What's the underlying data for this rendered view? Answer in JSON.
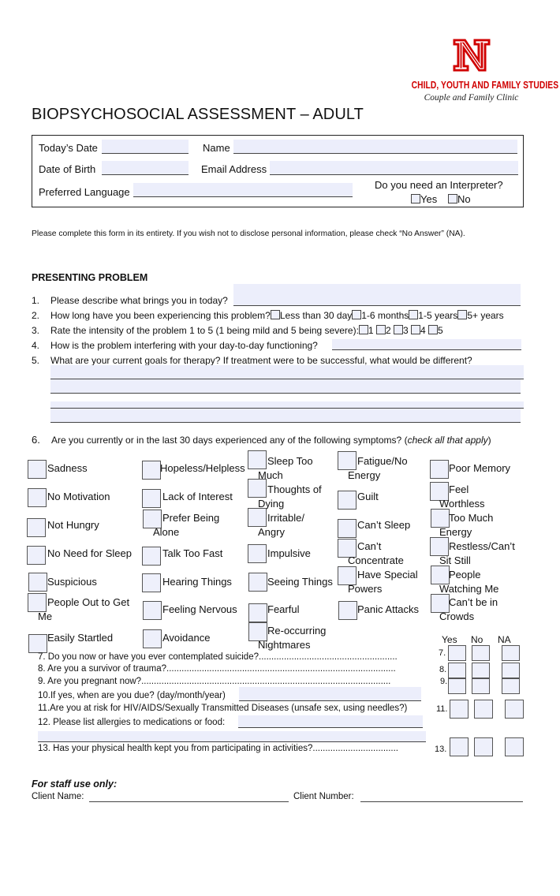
{
  "logo": {
    "icon": "university-n-logo-icon",
    "department": "CHILD, YOUTH AND FAMILY STUDIES",
    "clinic": "Couple and Family Clinic",
    "brand_color": "#d00000"
  },
  "title": "BIOPSYCHOSOCIAL ASSESSMENT – ADULT",
  "header": {
    "todays_date_label": "Today’s Date",
    "todays_date_value": "",
    "name_label": "Name",
    "name_value": "",
    "dob_label": "Date of Birth",
    "dob_value": "",
    "email_label": "Email Address",
    "email_value": "",
    "language_label": "Preferred Language",
    "language_value": "",
    "interpreter_question": "Do you need an Interpreter?",
    "interpreter_yes": "Yes",
    "interpreter_no": "No"
  },
  "instruction": "Please complete this form in its entirety. If you wish not to disclose personal information, please check “No Answer” (NA).",
  "presenting_problem": {
    "heading": "PRESENTING PROBLEM",
    "q1": {
      "num": "1.",
      "text": "Please describe what brings you in today?",
      "value": ""
    },
    "q2": {
      "num": "2.",
      "text": "How long have you been experiencing this problem?",
      "options": [
        "Less than 30 day",
        "1-6 months",
        "1-5 years",
        "5+ years"
      ]
    },
    "q3": {
      "num": "3.",
      "text": "Rate the intensity of the problem 1 to 5 (1 being mild and 5 being severe):",
      "options": [
        "1",
        "2",
        "3",
        "4",
        "5"
      ]
    },
    "q4": {
      "num": "4.",
      "text": "How is the problem interfering with your day-to-day functioning?",
      "value": ""
    },
    "q5": {
      "num": "5.",
      "text": "What are your current goals for therapy?  If treatment were to be successful, what would be different?",
      "lines": [
        "",
        "",
        "",
        ""
      ]
    }
  },
  "symptoms": {
    "num": "6.",
    "text": "Are you currently or in the last 30 days experienced any of the following symptoms? (",
    "hint": "check all that apply",
    "close": ")",
    "items": [
      "Sadness",
      "Hopeless/Helpless",
      "Sleep Too",
      "Much",
      "Fatigue/No",
      "Energy",
      "Poor Memory",
      "No Motivation",
      "Lack of Interest",
      "Thoughts of",
      "Dying",
      "Guilt",
      "Feel",
      "Worthless",
      "Not Hungry",
      "Prefer Being",
      "Alone",
      "Irritable/",
      "Angry",
      "Can’t Sleep",
      "Too Much",
      "Energy",
      "No Need for Sleep",
      "Talk Too Fast",
      "Impulsive",
      "Can’t",
      "Concentrate",
      "Restless/Can’t",
      "Sit Still",
      "Suspicious",
      "Hearing Things",
      "Seeing Things",
      "Have Special",
      "Powers",
      "People",
      "Watching Me",
      "People Out to Get",
      "Me",
      "Feeling Nervous",
      "Fearful",
      "Panic Attacks",
      "Can’t be in",
      "Crowds",
      "Easily Startled",
      "Avoidance",
      "Re-occurring",
      "Nightmares"
    ]
  },
  "yn_header": {
    "yes": "Yes",
    "no": "No",
    "na": "NA"
  },
  "health": {
    "q7": {
      "text": "7.  Do you now or have you ever contemplated suicide?.......................................................",
      "label": "7."
    },
    "q8": {
      "text": "8. Are you a survivor of trauma?...........................................................................................",
      "label": "8."
    },
    "q9": {
      "text": "9.  Are you pregnant now?...................................................................................................",
      "label": "9."
    },
    "q10": {
      "text": "10.If yes, when are you due? (day/month/year)",
      "value": ""
    },
    "q11": {
      "text": "11.Are you at risk for HIV/AIDS/Sexually Transmitted Diseases (unsafe sex, using needles?)",
      "label": "11."
    },
    "q12": {
      "text": "12. Please list allergies to medications or food:",
      "value": ""
    },
    "q13": {
      "text": "13. Has your physical health kept you from participating in activities?..................................",
      "label": "13."
    }
  },
  "staff": {
    "heading": "For staff use only:",
    "client_name_label": "Client Name:",
    "client_name_value": "",
    "client_number_label": "Client Number:",
    "client_number_value": ""
  }
}
